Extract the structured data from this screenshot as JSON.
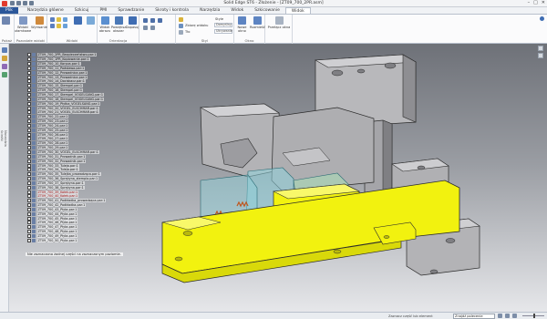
{
  "window": {
    "title": "Solid Edge ST6 - Złożenie - [ZT09_700_2PR.asm]",
    "controls": [
      "–",
      "□",
      "✕"
    ]
  },
  "tabs": [
    {
      "label": "Plik"
    },
    {
      "label": "Narzędzia główne"
    },
    {
      "label": "Szkicuj"
    },
    {
      "label": "PMI"
    },
    {
      "label": "Sprawdzanie"
    },
    {
      "label": "Skroty i kontrola"
    },
    {
      "label": "Narzędzia"
    },
    {
      "label": "Widok"
    },
    {
      "label": "Szkicowanie"
    },
    {
      "label": "Widok",
      "active": true
    }
  ],
  "ribbon": {
    "groups": [
      {
        "label": "Pokaż",
        "buttons": [
          "Okno",
          "Widok"
        ]
      },
      {
        "label": "Pozostałe widoki",
        "buttons": [
          "Widoki ułamkowe",
          "Wyrwanie"
        ]
      },
      {
        "label": "Widoki",
        "buttons": []
      },
      {
        "label": "Orientacja",
        "buttons": [
          "Widok obrazu",
          "Powiększ obszar",
          "Dopasuj"
        ]
      },
      {
        "label": "Styl",
        "buttons": []
      },
      {
        "label": "Okno",
        "buttons": [
          "Nowe okno",
          "Rozmieść"
        ]
      },
      {
        "label": "",
        "buttons": [
          "Przełącz okna"
        ]
      }
    ],
    "style_label": "Style",
    "style_value": "Domyślny",
    "display_label": "Zbiorę widoku",
    "display_value": "Ustawienia",
    "background_label": "Tło",
    "background_value": "Ukrywanie"
  },
  "left_strip": {
    "pane_label": "Narzędzia ścieżki"
  },
  "tree": {
    "items": [
      {
        "label": "ZT09_700_2PR_Bezpieczeństwo.par:1"
      },
      {
        "label": "ZT09_700_1PR_Kopiowanie.par:1"
      },
      {
        "label": "ZT09_700_10_Korpus.par:1"
      },
      {
        "label": "ZT09_700_11_Podstawa.par:1"
      },
      {
        "label": "ZT09_700_12_Prowadnica.par:1"
      },
      {
        "label": "ZT09_700_13_Prowadnica.par:1"
      },
      {
        "label": "ZT09_700_14_Dociskacz.par:1"
      },
      {
        "label": "ZT09_700_15_Stempel.par:1"
      },
      {
        "label": "ZT09_700_16_Stempel.par:1"
      },
      {
        "label": "ZT09_700_17_Stempel_VOGELSANG.par:1"
      },
      {
        "label": "ZT09_700_18_Stempel_VOGELSANG.par:1"
      },
      {
        "label": "ZT09_700_19_Płytka_VOGELSANG.par:1"
      },
      {
        "label": "ZT09_700_20_VOGEL_ELSCHMAR.par:1"
      },
      {
        "label": "ZT09_700_21_VOGEL_ELSCHMAR.par:1"
      },
      {
        "label": "ZT09_700_22.par:1"
      },
      {
        "label": "ZT09_700_23.par:1"
      },
      {
        "label": "ZT09_700_24.par:1"
      },
      {
        "label": "ZT09_700_25.par:1"
      },
      {
        "label": "ZT09_700_26.par:1"
      },
      {
        "label": "ZT09_700_27.par:1"
      },
      {
        "label": "ZT09_700_28.par:1"
      },
      {
        "label": "ZT09_700_29.par:1"
      },
      {
        "label": "ZT09_700_30_VOGEL_ELSCHMAR.par:1"
      },
      {
        "label": "ZT09_700_31_Prowadnik.par:1"
      },
      {
        "label": "ZT09_700_32_Prowadnik.par:1"
      },
      {
        "label": "ZT09_700_33_Tuleja.par:1"
      },
      {
        "label": "ZT09_700_34_Tuleja.par:1"
      },
      {
        "label": "ZT09_700_35_Tulejka_prowadząca.par:1"
      },
      {
        "label": "ZT09_700_36_Sprężyna_stempla.par:1"
      },
      {
        "label": "ZT09_700_37_Sprężyna.par:1"
      },
      {
        "label": "ZT09_700_38_Sprężyna.par:1"
      },
      {
        "label": "ZT09_700_39_Kołek.par:1",
        "err": true
      },
      {
        "label": "ZT09_700_40_Kołek.par:1",
        "err": true
      },
      {
        "label": "ZT09_700_41_Podkładka_prowadząca.par:1"
      },
      {
        "label": "ZT09_700_42_Podkładka.par:1"
      },
      {
        "label": "ZT09_700_43_Płyta.par:1"
      },
      {
        "label": "ZT09_700_44_Płyta.par:1"
      },
      {
        "label": "ZT09_700_45_Płyta.par:1"
      },
      {
        "label": "ZT09_700_46_Płyta.par:1"
      },
      {
        "label": "ZT09_700_47_Płyta.par:1"
      },
      {
        "label": "ZT09_700_48_Płyta.par:1"
      },
      {
        "label": "ZT09_700_49_Płyta.par:1"
      },
      {
        "label": "ZT09_700_50_Płyta.par:1"
      }
    ],
    "status": "Nie zaznaczono żadnej części na zaznaczonym poziomie."
  },
  "status_bar": {
    "hint": "Zaznacz część lub element",
    "command_placeholder": "Znajdź polecenie"
  },
  "colors": {
    "accent": "#2b579a",
    "yellow_parts": "#f2f20f",
    "gray_parts": "#b5b5b8",
    "transparent_parts": "#8fd3dc"
  }
}
